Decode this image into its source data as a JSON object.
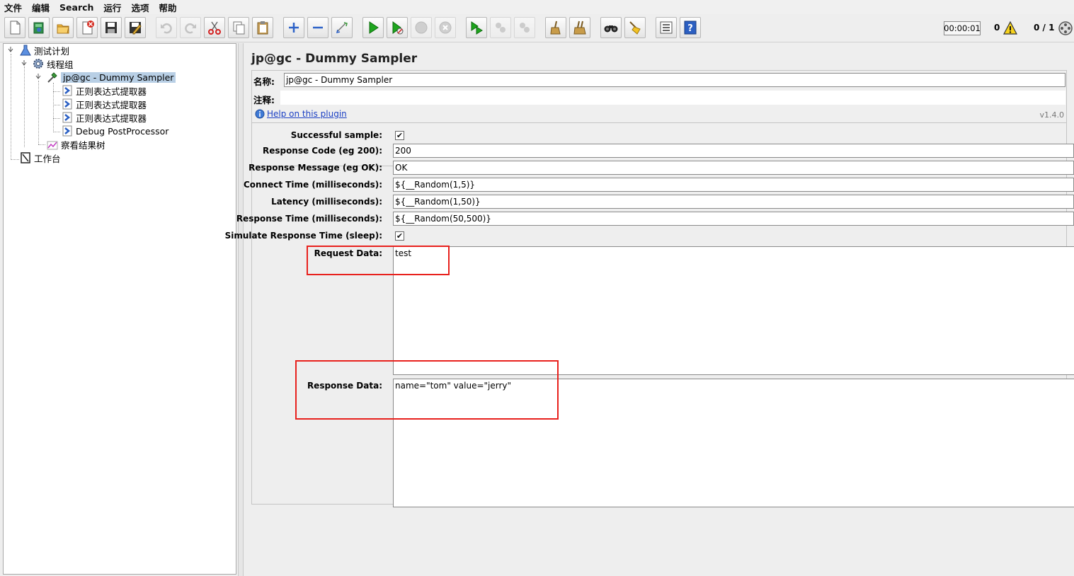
{
  "menu": [
    "文件",
    "编辑",
    "Search",
    "运行",
    "选项",
    "帮助"
  ],
  "toolbar": {
    "timer": "00:00:01",
    "warnings": "0",
    "threads": "0 / 1"
  },
  "tree": {
    "items": [
      {
        "label": "测试计划",
        "icon": "test-plan-icon"
      },
      {
        "label": "线程组",
        "icon": "thread-group-gear-icon"
      },
      {
        "label": "jp@gc - Dummy Sampler",
        "icon": "sampler-pipette-icon"
      },
      {
        "label": "正则表达式提取器",
        "icon": "post-processor-arrow-icon"
      },
      {
        "label": "正则表达式提取器",
        "icon": "post-processor-arrow-icon"
      },
      {
        "label": "正则表达式提取器",
        "icon": "post-processor-arrow-icon"
      },
      {
        "label": "Debug PostProcessor",
        "icon": "post-processor-arrow-icon"
      },
      {
        "label": "察看结果树",
        "icon": "listener-graph-icon"
      },
      {
        "label": "工作台",
        "icon": "workbench-icon"
      }
    ]
  },
  "panel": {
    "title": "jp@gc - Dummy Sampler",
    "name_label": "名称:",
    "name_value": "jp@gc - Dummy Sampler",
    "comment_label": "注释:",
    "comment_value": "",
    "help_link": "Help on this plugin",
    "version": "v1.4.0"
  },
  "form": {
    "successful_label": "Successful sample:",
    "successful_checked": "✔",
    "code_label": "Response Code (eg 200):",
    "code_value": "200",
    "message_label": "Response Message (eg OK):",
    "message_value": "OK",
    "connect_label": "Connect Time (milliseconds):",
    "connect_value": "${__Random(1,5)}",
    "latency_label": "Latency (milliseconds):",
    "latency_value": "${__Random(1,50)}",
    "response_time_label": "Response Time (milliseconds):",
    "response_time_value": "${__Random(50,500)}",
    "simulate_label": "Simulate Response Time (sleep):",
    "simulate_checked": "✔",
    "request_label": "Request Data:",
    "request_value": "test",
    "response_label": "Response Data:",
    "response_value": "name=\"tom\"  value=\"jerry\""
  },
  "colors": {
    "highlight": "#e8211d",
    "selection": "#b8cfe5",
    "link": "#1a3fc4"
  }
}
